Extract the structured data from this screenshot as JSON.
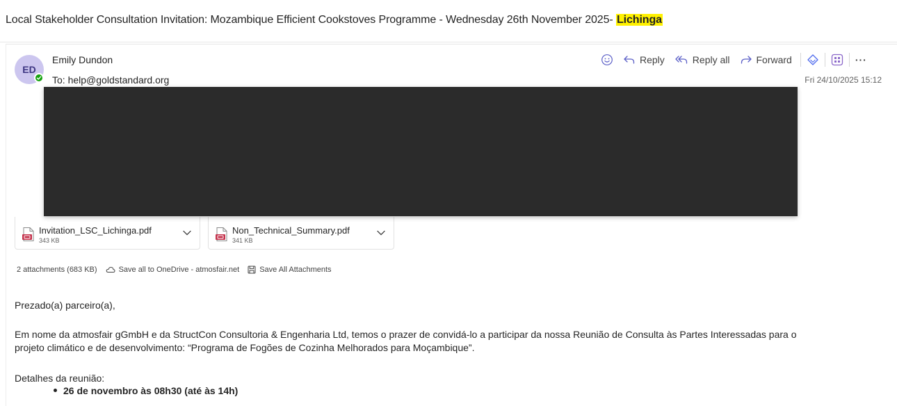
{
  "email": {
    "subject_prefix": "Local Stakeholder Consultation Invitation: Mozambique Efficient Cookstoves Programme - Wednesday 26th November 2025- ",
    "subject_highlight": "Lichinga",
    "sender": {
      "initials": "ED",
      "name": "Emily Dundon",
      "to_prefix": "To:",
      "to_address": "help@goldstandard.org",
      "datetime": "Fri 24/10/2025 15:12",
      "presence": "available"
    },
    "actions": {
      "reply": "Reply",
      "reply_all": "Reply all",
      "forward": "Forward",
      "more": "···"
    },
    "attachments": [
      {
        "name": "Invitation_LSC_Lichinga.pdf",
        "size": "343 KB"
      },
      {
        "name": "Non_Technical_Summary.pdf",
        "size": "341 KB"
      }
    ],
    "attachment_bar": {
      "count_label": "2 attachments (683 KB)",
      "save_onedrive": "Save all to OneDrive - atmosfair.net",
      "save_all": "Save All Attachments"
    },
    "body": {
      "greeting": "Prezado(a) parceiro(a),",
      "paragraph1_line1": "Em nome da atmosfair gGmbH e da StructCon Consultoria & Engenharia Ltd, temos o prazer de convidá-lo a participar da nossa Reunião de Consulta às Partes Interessadas para o",
      "paragraph1_line2": "projeto climático e de desenvolvimento: “Programa de Fogões de Cozinha Melhorados para Moçambique”.",
      "details_heading": "Detalhes da reunião:",
      "bullets": [
        "26 de novembro às 08h30 (até às 14h)"
      ]
    }
  },
  "colors": {
    "highlight": "#fff100",
    "avatar_bg": "#ccc6ef",
    "presence": "#13a10e",
    "reply_icon": "#5b5fc7",
    "forward_icon": "#5b5fc7",
    "pdf_icon": "#c4314b",
    "redaction": "#2b2b2b"
  }
}
